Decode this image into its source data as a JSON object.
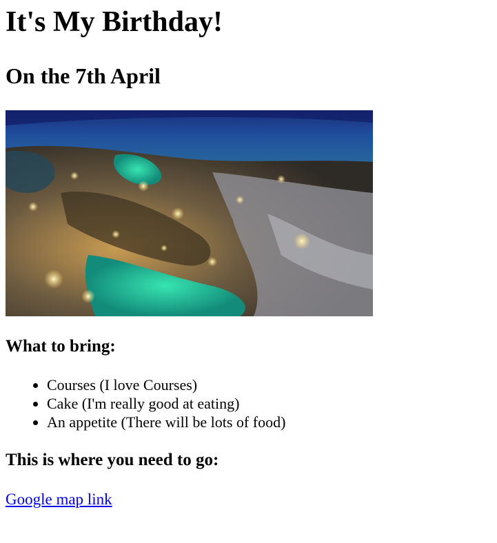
{
  "page": {
    "title": "It's My Birthday!",
    "date_heading": "On the 7th April",
    "hero_image": {
      "alt": ""
    },
    "bring_heading": "What to bring:",
    "bring_items": [
      "Courses (I love Courses)",
      "Cake (I'm really good at eating)",
      "An appetite (There will be lots of food)"
    ],
    "where_heading": "This is where you need to go:",
    "map_link_label": "Google map link"
  },
  "colors": {
    "link": "#0000ee",
    "text": "#000000",
    "background": "#ffffff"
  }
}
